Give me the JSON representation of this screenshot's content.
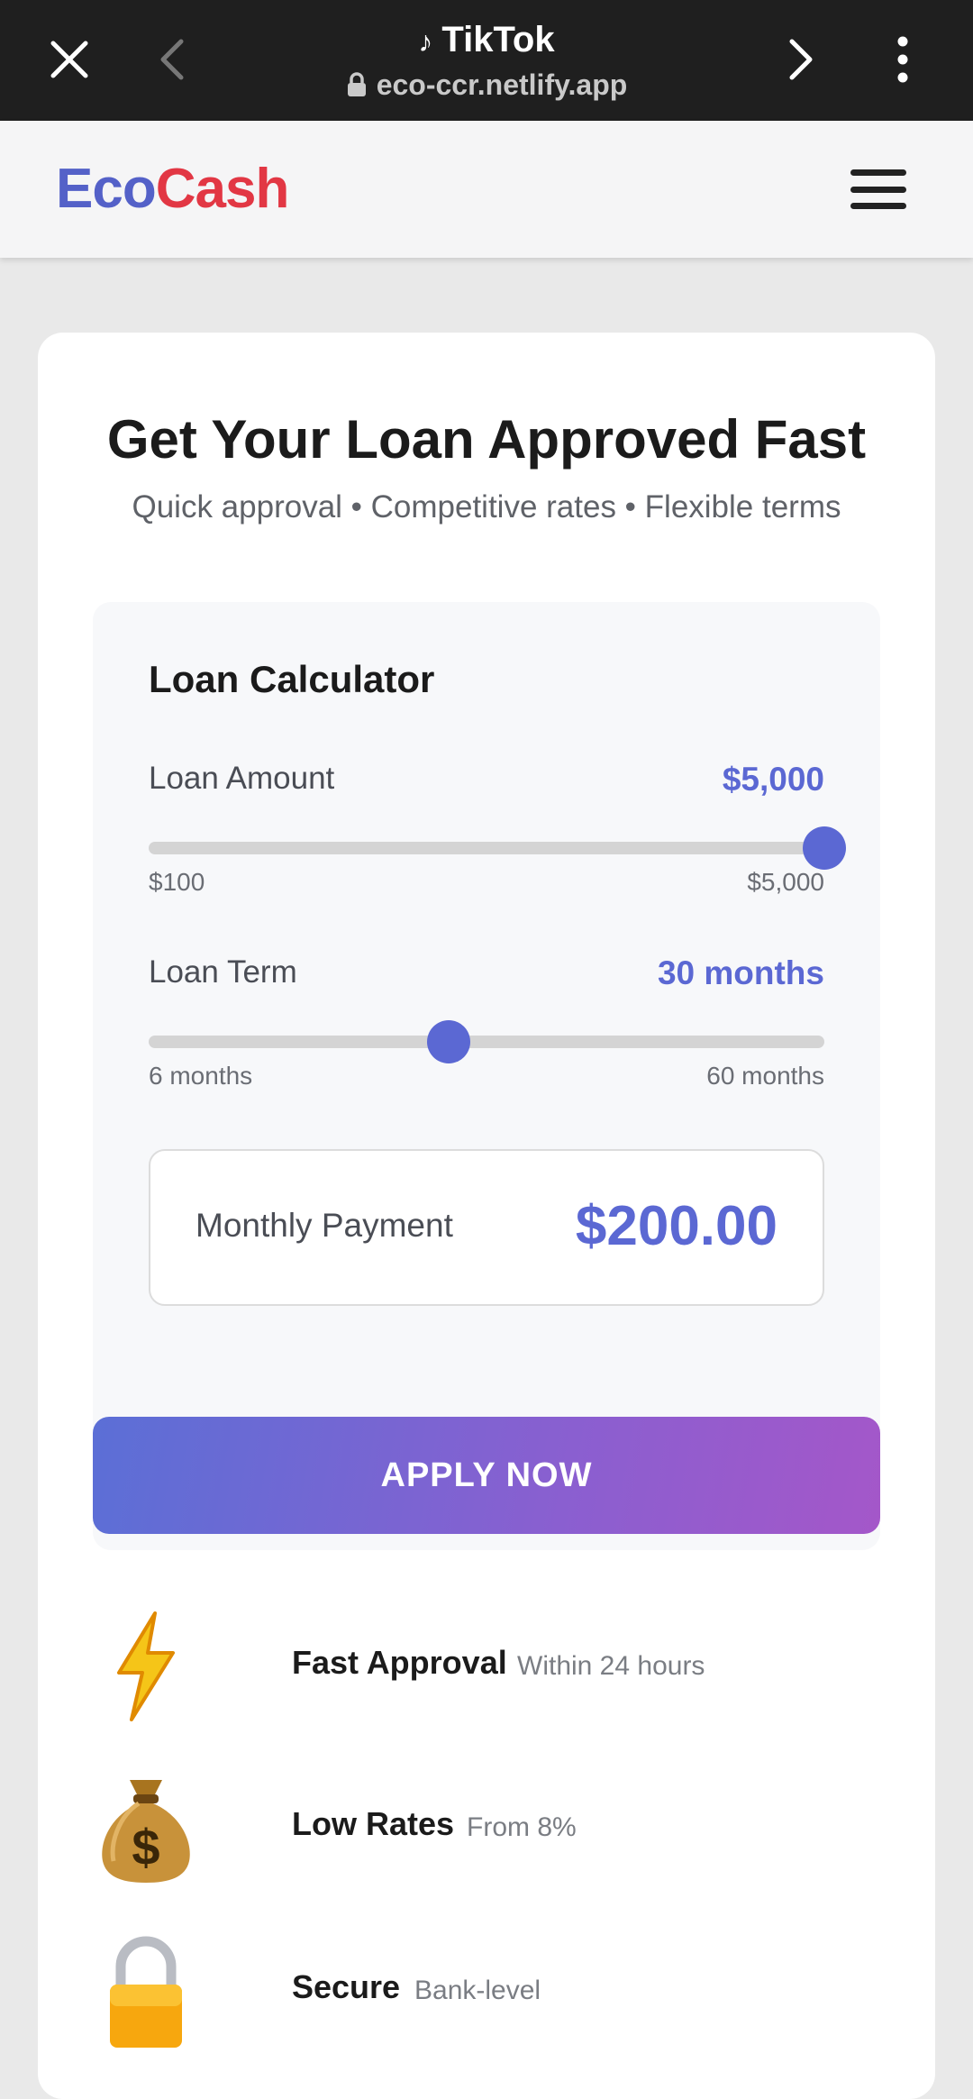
{
  "browser": {
    "title": "TikTok",
    "url": "eco-ccr.netlify.app"
  },
  "header": {
    "logo_part1": "Eco",
    "logo_part2": "Cash"
  },
  "hero": {
    "title": "Get Your Loan Approved Fast",
    "subtitle": "Quick approval • Competitive rates • Flexible terms"
  },
  "calculator": {
    "title": "Loan Calculator",
    "amount": {
      "label": "Loan Amount",
      "value": "$5,000",
      "min": "$100",
      "max": "$5,000",
      "fraction": 1.0
    },
    "term": {
      "label": "Loan Term",
      "value": "30 months",
      "min": "6 months",
      "max": "60 months",
      "fraction": 0.444
    },
    "payment": {
      "label": "Monthly Payment",
      "value": "$200.00"
    }
  },
  "apply_button": "APPLY NOW",
  "features": [
    {
      "name": "Fast Approval",
      "desc": "Within 24 hours",
      "icon": "lightning-icon"
    },
    {
      "name": "Low Rates",
      "desc": "From 8%",
      "icon": "money-bag-icon"
    },
    {
      "name": "Secure",
      "desc": "Bank-level",
      "icon": "lock-icon"
    }
  ],
  "colors": {
    "accent": "#5b68d3",
    "logo_blue": "#5461c8",
    "logo_red": "#e23744"
  }
}
